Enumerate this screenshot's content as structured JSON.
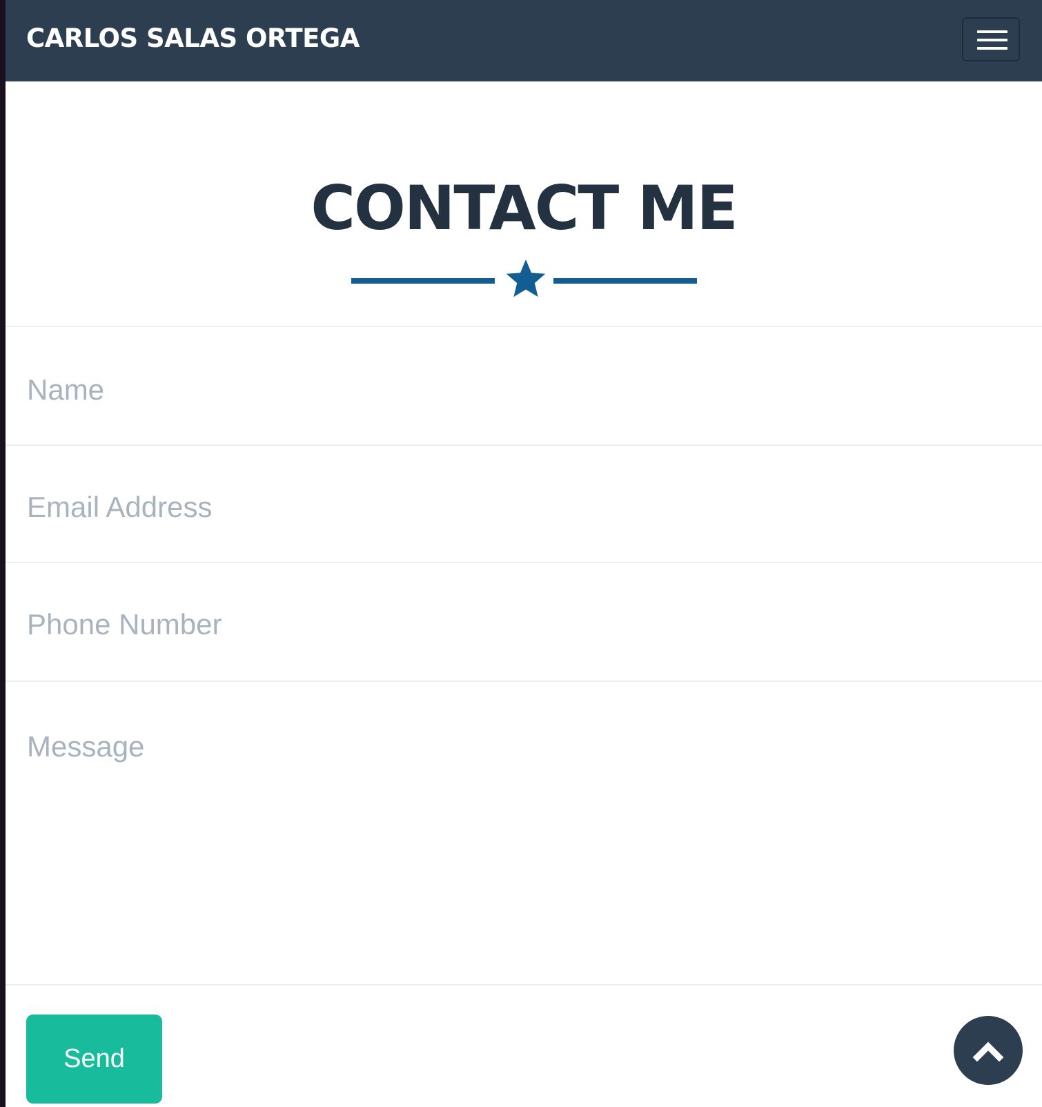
{
  "navbar": {
    "brand": "CARLOS SALAS ORTEGA",
    "menu_icon": "hamburger-icon"
  },
  "section": {
    "title": "CONTACT ME",
    "divider_icon": "star-icon"
  },
  "form": {
    "name_placeholder": "Name",
    "email_placeholder": "Email Address",
    "phone_placeholder": "Phone Number",
    "message_placeholder": "Message",
    "send_label": "Send"
  },
  "scroll_top_icon": "chevron-up-icon",
  "colors": {
    "navbar": "#2c3e50",
    "accent": "#18bc9c",
    "divider": "#125d93",
    "heading": "#233140"
  }
}
